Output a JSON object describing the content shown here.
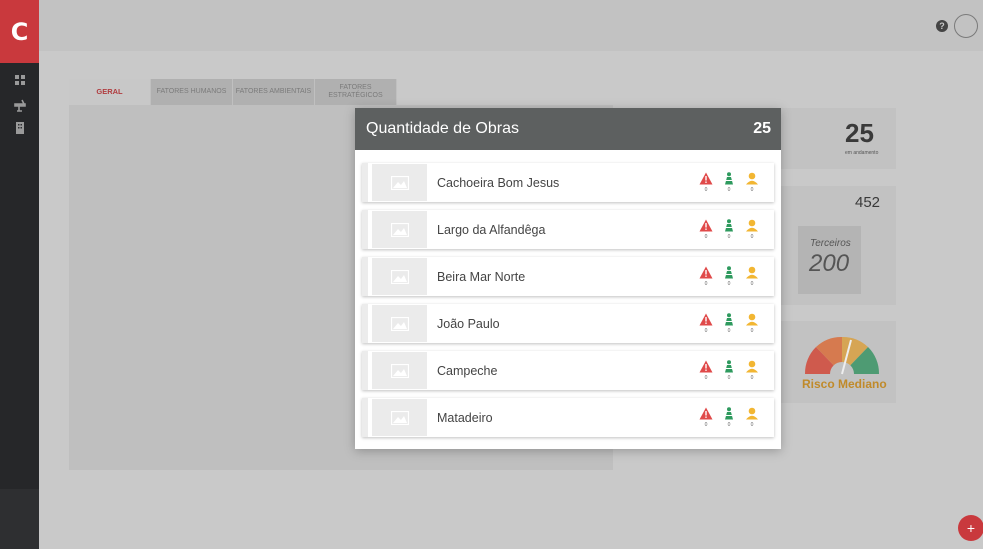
{
  "app": {
    "logo_letter": "C"
  },
  "header": {
    "help_icon": "?"
  },
  "tabs": [
    {
      "label": "GERAL",
      "active": true
    },
    {
      "label": "FATORES HUMANOS",
      "active": false
    },
    {
      "label": "FATORES AMBIENTAIS",
      "active": false
    },
    {
      "label": "FATORES ESTRATÉGICOS",
      "active": false
    }
  ],
  "cards": {
    "obras_count": "25",
    "obras_sub": "em andamento",
    "workers_total": "452",
    "terceiros_label": "Terceiros",
    "terceiros_value": "200",
    "risk_label": "Risco Mediano"
  },
  "modal": {
    "title": "Quantidade de Obras",
    "count": "25",
    "items": [
      {
        "name": "Cachoeira Bom Jesus",
        "alerts": "0",
        "workers": "0",
        "people": "0"
      },
      {
        "name": "Largo da Alfandêga",
        "alerts": "0",
        "workers": "0",
        "people": "0"
      },
      {
        "name": "Beira Mar Norte",
        "alerts": "0",
        "workers": "0",
        "people": "0"
      },
      {
        "name": "João Paulo",
        "alerts": "0",
        "workers": "0",
        "people": "0"
      },
      {
        "name": "Campeche",
        "alerts": "0",
        "workers": "0",
        "people": "0"
      },
      {
        "name": "Matadeiro",
        "alerts": "0",
        "workers": "0",
        "people": "0"
      }
    ]
  },
  "colors": {
    "brand_red": "#c9393d",
    "alert_red": "#e04a4a",
    "worker_green": "#2e9a5e",
    "person_yellow": "#f2b632"
  },
  "fab": {
    "label": "+"
  }
}
